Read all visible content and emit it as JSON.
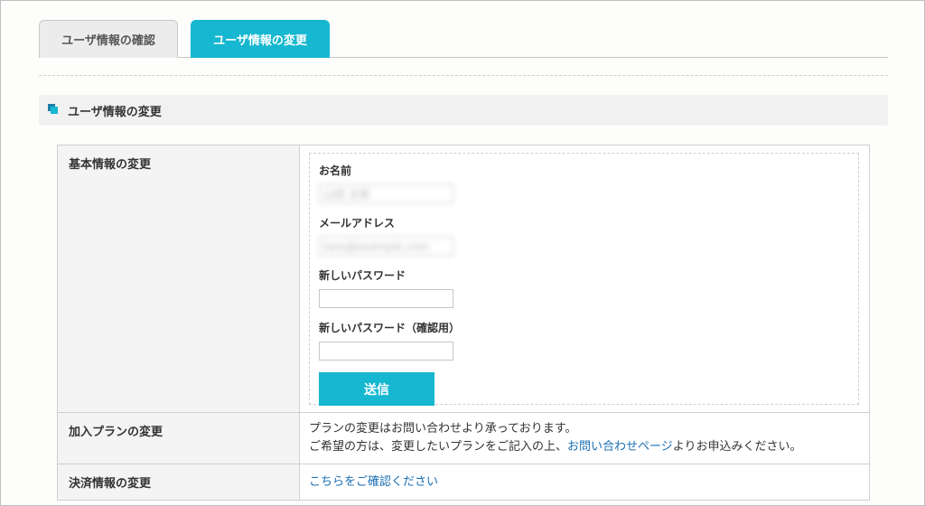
{
  "tabs": [
    {
      "label": "ユーザ情報の確認",
      "active": false
    },
    {
      "label": "ユーザ情報の変更",
      "active": true
    }
  ],
  "section": {
    "title": "ユーザ情報の変更"
  },
  "basic_info": {
    "label": "基本情報の変更",
    "name_label": "お名前",
    "name_value": "山田 太郎",
    "email_label": "メールアドレス",
    "email_value": "taro@example.com",
    "password_label": "新しいパスワード",
    "password_confirm_label": "新しいパスワード（確認用）",
    "submit_label": "送信"
  },
  "plan": {
    "label": "加入プランの変更",
    "line1": "プランの変更はお問い合わせより承っております。",
    "line2_prefix": "ご希望の方は、変更したいプランをご記入の上、",
    "line2_link": "お問い合わせページ",
    "line2_suffix": "よりお申込みください。"
  },
  "payment": {
    "label": "決済情報の変更",
    "link": "こちらをご確認ください"
  },
  "colors": {
    "accent": "#16b7d0",
    "link": "#1a6fb3"
  }
}
